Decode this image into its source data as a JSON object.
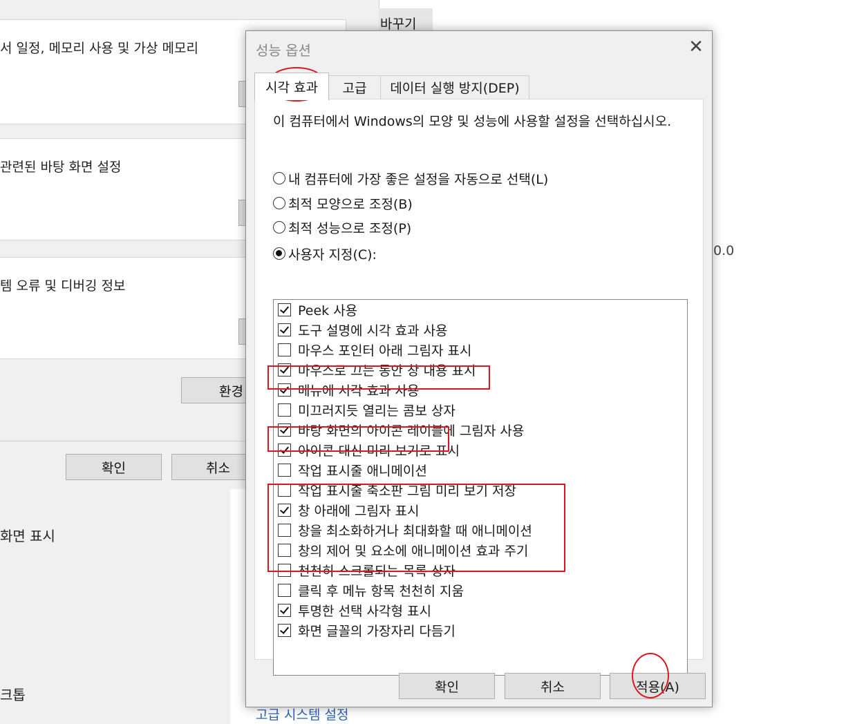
{
  "background": {
    "perf_text": "서 일정, 메모리 사용 및 가상 메모리",
    "profile_text": "관련된 바탕 화면 설정",
    "startup_text": "템 오류 및 디버깅 정보",
    "env_button": "환경",
    "ok_button": "확인",
    "cancel_button": "취소",
    "side_tab_label": "바꾸기",
    "version_fragment": "0.0",
    "left_item_1": "화면 표시",
    "left_item_2": "크톱",
    "bottom_link": "고급 시스템 설정"
  },
  "dialog": {
    "title": "성능 옵션",
    "close_glyph": "✕",
    "tabs": [
      {
        "label": "시각 효과",
        "active": true
      },
      {
        "label": "고급",
        "active": false
      },
      {
        "label": "데이터 실행 방지(DEP)",
        "active": false
      }
    ],
    "description": "이 컴퓨터에서 Windows의 모양 및 성능에 사용할 설정을 선택하십시오.",
    "radios": [
      {
        "label": "내 컴퓨터에 가장 좋은 설정을 자동으로 선택(L)",
        "checked": false
      },
      {
        "label": "최적 모양으로 조정(B)",
        "checked": false
      },
      {
        "label": "최적 성능으로 조정(P)",
        "checked": false
      },
      {
        "label": "사용자 지정(C):",
        "checked": true
      }
    ],
    "options": [
      {
        "label": "Peek 사용",
        "checked": true
      },
      {
        "label": "도구 설명에 시각 효과 사용",
        "checked": true
      },
      {
        "label": "마우스 포인터 아래 그림자 표시",
        "checked": false
      },
      {
        "label": "마우스로 끄는 동안 창 내용 표시",
        "checked": true
      },
      {
        "label": "메뉴에 시각 효과 사용",
        "checked": true
      },
      {
        "label": "미끄러지듯 열리는 콤보 상자",
        "checked": false
      },
      {
        "label": "바탕 화면의 아이콘 레이블에 그림자 사용",
        "checked": true
      },
      {
        "label": "아이콘 대신 미리 보기로 표시",
        "checked": true
      },
      {
        "label": "작업 표시줄 애니메이션",
        "checked": false
      },
      {
        "label": "작업 표시줄 축소판 그림 미리 보기 저장",
        "checked": false
      },
      {
        "label": "창 아래에 그림자 표시",
        "checked": true
      },
      {
        "label": "창을 최소화하거나 최대화할 때 애니메이션",
        "checked": false
      },
      {
        "label": "창의 제어 및 요소에 애니메이션 효과 주기",
        "checked": false
      },
      {
        "label": "천천히 스크롤되는 목록 상자",
        "checked": false
      },
      {
        "label": "클릭 후 메뉴 항목 천천히 지움",
        "checked": false
      },
      {
        "label": "투명한 선택 사각형 표시",
        "checked": true
      },
      {
        "label": "화면 글꼴의 가장자리 다듬기",
        "checked": true
      }
    ],
    "buttons": {
      "ok": "확인",
      "cancel": "취소",
      "apply": "적용(A)"
    }
  },
  "colors": {
    "annotation_red": "#e0141e",
    "dialog_bg": "#f0f0f0",
    "panel_bg": "#ffffff"
  }
}
